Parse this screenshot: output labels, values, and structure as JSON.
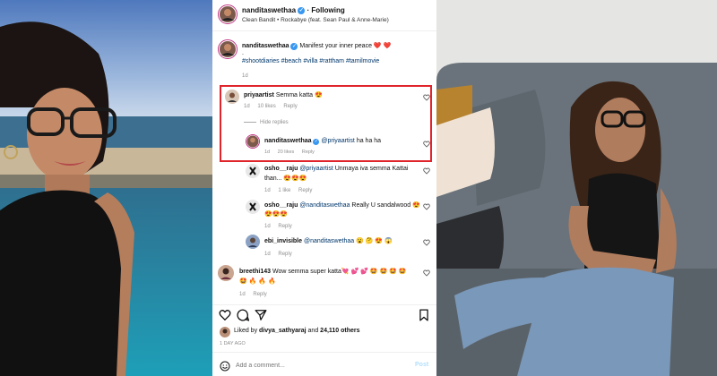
{
  "post": {
    "username": "nanditaswethaa",
    "follow_state": "Following",
    "song": "Clean Bandit • Rockabye (feat. Sean Paul & Anne-Marie)",
    "caption_text": "Manifest your inner peace ❤️ ❤️",
    "caption_dot": ".",
    "hashtags": "#shootdiaries #beach #villa #rattham #tamilmovie",
    "caption_time": "1d"
  },
  "comments": [
    {
      "user": "priyaartist",
      "text": "Semma katta 😍",
      "time": "1d",
      "likes": "10 likes",
      "reply": "Reply",
      "hide_replies": "Hide replies"
    },
    {
      "user": "nanditaswethaa",
      "mention": "@priyaartist",
      "text": "ha ha ha",
      "time": "1d",
      "likes": "20 likes",
      "reply": "Reply"
    },
    {
      "user": "osho__raju",
      "mention": "@priyaartist",
      "text": "Unmaya iva semma Kattai",
      "text2": "than... 😍😍😍",
      "time": "1d",
      "likes": "1 like",
      "reply": "Reply"
    },
    {
      "user": "osho__raju",
      "mention": "@nanditaswethaa",
      "text": "Really U sandalwood 😍",
      "text2": "😍😍😍",
      "time": "1d",
      "reply": "Reply"
    },
    {
      "user": "ebi_invisible",
      "mention": "@nanditaswethaa",
      "text": "😮 🤔 😍 😱",
      "time": "1d",
      "reply": "Reply"
    },
    {
      "user": "breethi143",
      "text": "Wow semma super katta💘 💕 💕 🤩 🤩 🤩 🤩",
      "text2": "🤩 🔥 🔥 🔥",
      "time": "1d",
      "reply": "Reply"
    }
  ],
  "actions": {
    "liked_prefix": "Liked by",
    "liked_user": "divya_sathyaraj",
    "liked_and": "and",
    "liked_others": "24,110 others",
    "time_ago": "1 DAY AGO",
    "add_comment_placeholder": "Add a comment...",
    "post_label": "Post"
  },
  "colors": {
    "highlight": "#e0242b",
    "accent": "#3897f0",
    "muted": "#8e8e8e",
    "heart": "#ed4956"
  },
  "icons": [
    "heart-icon",
    "comment-icon",
    "share-icon",
    "bookmark-icon",
    "verified-badge-icon",
    "emoji-icon"
  ]
}
